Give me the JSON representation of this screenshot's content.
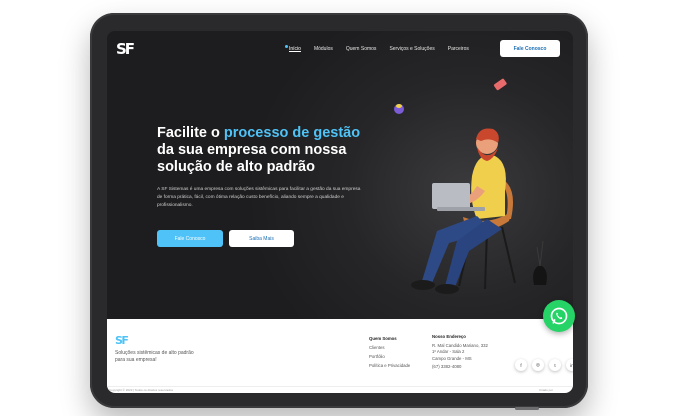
{
  "brand": {
    "logo_text": "SF"
  },
  "nav": {
    "items": [
      "Início",
      "Módulos",
      "Quem Somos",
      "Serviços e Soluções",
      "Parceiros"
    ],
    "cta": "Fale Conosco"
  },
  "hero": {
    "title_prefix": "Facilite o ",
    "title_highlight": "processo de gestão",
    "title_rest": " da sua empresa com nossa solução de alto padrão",
    "description": "A SF Sistemas é uma empresa com soluções sistêmicas para facilitar a gestão da sua empresa de forma prática, fácil, com ótima relação custo benefício, aliando sempre a qualidade e profissionalismo.",
    "primary_button": "Fale Conosco",
    "secondary_button": "Saiba Mais"
  },
  "footer": {
    "logo_text": "SF",
    "tagline": "Soluções sistêmicas de alto padrão para sua empresa!",
    "links_title": "Quem Somos",
    "links": [
      "Clientes",
      "Portfólio",
      "Política e Privacidade"
    ],
    "address_title": "Nosso Endereço",
    "address_lines": [
      "R. Mal Candido Mariano, 332",
      "1º Andar - Sala 2",
      "Campo Grande - MS"
    ],
    "phone": "(67) 3382-4080",
    "social": [
      "f",
      "◎",
      "t",
      "in"
    ],
    "copyright": "Copyright © 2023 | Todos os direitos reservados",
    "credit": "Criado por"
  },
  "colors": {
    "accent": "#4fc3f7",
    "hero_bg": "#1f1f21",
    "whatsapp": "#25d366"
  }
}
